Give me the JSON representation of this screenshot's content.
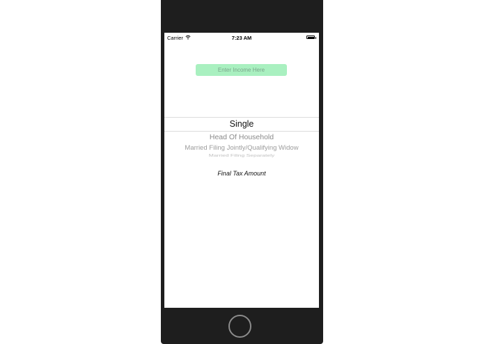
{
  "status_bar": {
    "carrier": "Carrier",
    "time": "7:23 AM",
    "wifi_icon": "wifi-icon",
    "battery_icon": "battery-icon"
  },
  "income_field": {
    "placeholder": "Enter Income Here",
    "value": "",
    "background_color": "#a9f0c0"
  },
  "filing_status_picker": {
    "selected": "Single",
    "options": [
      "Single",
      "Head Of Household",
      "Married Filing Jointly/Qualifying Widow",
      "Married Filing Separately"
    ]
  },
  "result": {
    "label": "Final Tax Amount"
  },
  "device": {
    "home_button_icon": "home-button"
  }
}
